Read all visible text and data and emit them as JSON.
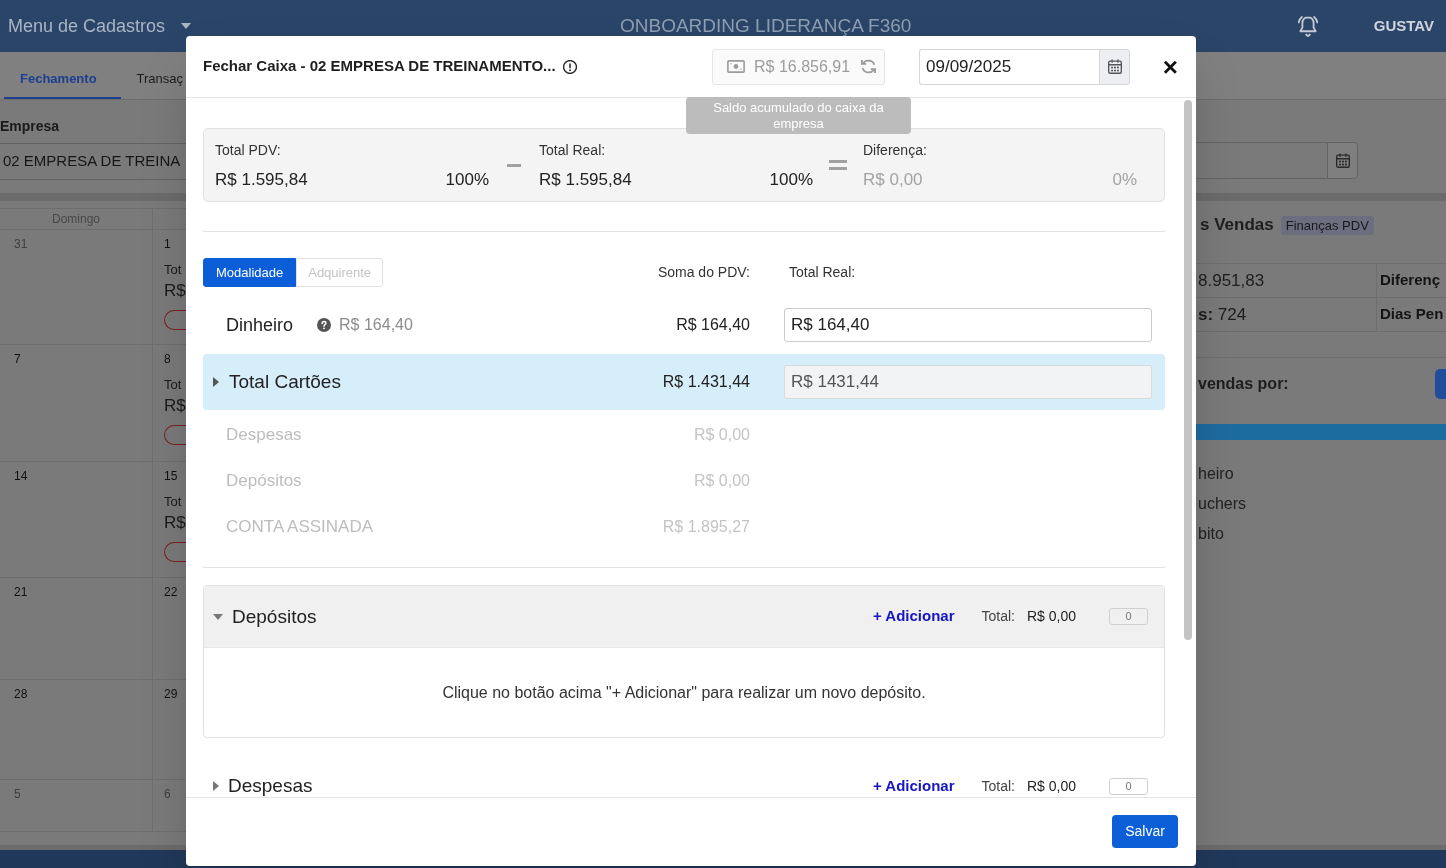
{
  "background": {
    "top_bar": {
      "menu": "Menu de Cadastros",
      "title": "ONBOARDING LIDERANÇA F360",
      "user": "GUSTAV"
    },
    "tabs": [
      {
        "label": "Fechamento",
        "selected": true
      },
      {
        "label": "Transaç",
        "selected": false
      }
    ],
    "company_filter": {
      "label": "Empresa",
      "value": "02 EMPRESA DE TREINA"
    },
    "calendar": {
      "weekday": "Domingo",
      "weeks": [
        {
          "days": [
            {
              "date": "31",
              "outside": true,
              "kind": "empty"
            },
            {
              "date": "1",
              "outside": false,
              "kind": "totals",
              "label": "Tot",
              "amount": "R$"
            }
          ]
        },
        {
          "days": [
            {
              "date": "7",
              "outside": false,
              "kind": "empty"
            },
            {
              "date": "8",
              "outside": false,
              "kind": "totals",
              "label": "Tot",
              "amount": "R$"
            }
          ]
        },
        {
          "days": [
            {
              "date": "14",
              "outside": false,
              "kind": "empty"
            },
            {
              "date": "15",
              "outside": false,
              "kind": "totals",
              "label": "Tot",
              "amount": "R$"
            }
          ]
        },
        {
          "days": [
            {
              "date": "21",
              "outside": false,
              "kind": "empty"
            },
            {
              "date": "22",
              "outside": false,
              "kind": "empty"
            }
          ]
        },
        {
          "days": [
            {
              "date": "28",
              "outside": false,
              "kind": "empty"
            },
            {
              "date": "29",
              "outside": false,
              "kind": "empty"
            }
          ]
        },
        {
          "days": [
            {
              "date": "5",
              "outside": true,
              "kind": "empty"
            },
            {
              "date": "6",
              "outside": true,
              "kind": "empty"
            }
          ]
        }
      ]
    },
    "sales_panel": {
      "title": "s Vendas",
      "badge": "Finanças PDV",
      "table": [
        [
          "8.951,83",
          "Diferenç"
        ],
        [
          "**s:** 724",
          "Dias Pen"
        ]
      ],
      "group_by_label": "vendas por:",
      "legend": [
        "heiro",
        "uchers",
        "bito"
      ]
    }
  },
  "modal": {
    "title": "Fechar Caixa - 02 EMPRESA DE TREINAMENTO...",
    "balance": "R$ 16.856,91",
    "tooltip": "Saldo acumulado do caixa da empresa",
    "date": "09/09/2025",
    "close": "×",
    "summary": [
      {
        "label": "Total PDV:",
        "value": "R$ 1.595,84",
        "percent": "100%",
        "muted": false
      },
      {
        "label": "Total Real:",
        "value": "R$ 1.595,84",
        "percent": "100%",
        "muted": false
      },
      {
        "label": "Diferença:",
        "value": "R$ 0,00",
        "percent": "0%",
        "muted": true
      }
    ],
    "view_toggle": [
      {
        "label": "Modalidade",
        "selected": true
      },
      {
        "label": "Adquirente",
        "selected": false
      }
    ],
    "columns": [
      "Soma do PDV:",
      "Total Real:"
    ],
    "rows": [
      {
        "kind": "entry",
        "label": "Dinheiro",
        "hint": "R$ 164,40",
        "pdv": "R$ 164,40",
        "real": {
          "value": "R$ 164,40",
          "disabled": false
        }
      },
      {
        "kind": "group",
        "label": "Total Cartões",
        "expanded": false,
        "pdv": "R$ 1.431,44",
        "real": {
          "value": "R$ 1431,44",
          "disabled": true
        }
      },
      {
        "kind": "info",
        "label": "Despesas",
        "pdv": "R$ 0,00"
      },
      {
        "kind": "info",
        "label": "Depósitos",
        "pdv": "R$ 0,00"
      },
      {
        "kind": "info",
        "label": "CONTA ASSINADA",
        "pdv": "R$ 1.895,27"
      }
    ],
    "sections": [
      {
        "title": "Depósitos",
        "expanded": true,
        "add": "+ Adicionar",
        "total_label": "Total:",
        "total": "R$ 0,00",
        "count": "0",
        "empty_message": "Clique no botão acima \"+ Adicionar\" para realizar um novo depósito."
      },
      {
        "title": "Despesas",
        "expanded": false,
        "add": "+ Adicionar",
        "total_label": "Total:",
        "total": "R$ 0,00",
        "count": "0"
      }
    ],
    "save": "Salvar"
  }
}
